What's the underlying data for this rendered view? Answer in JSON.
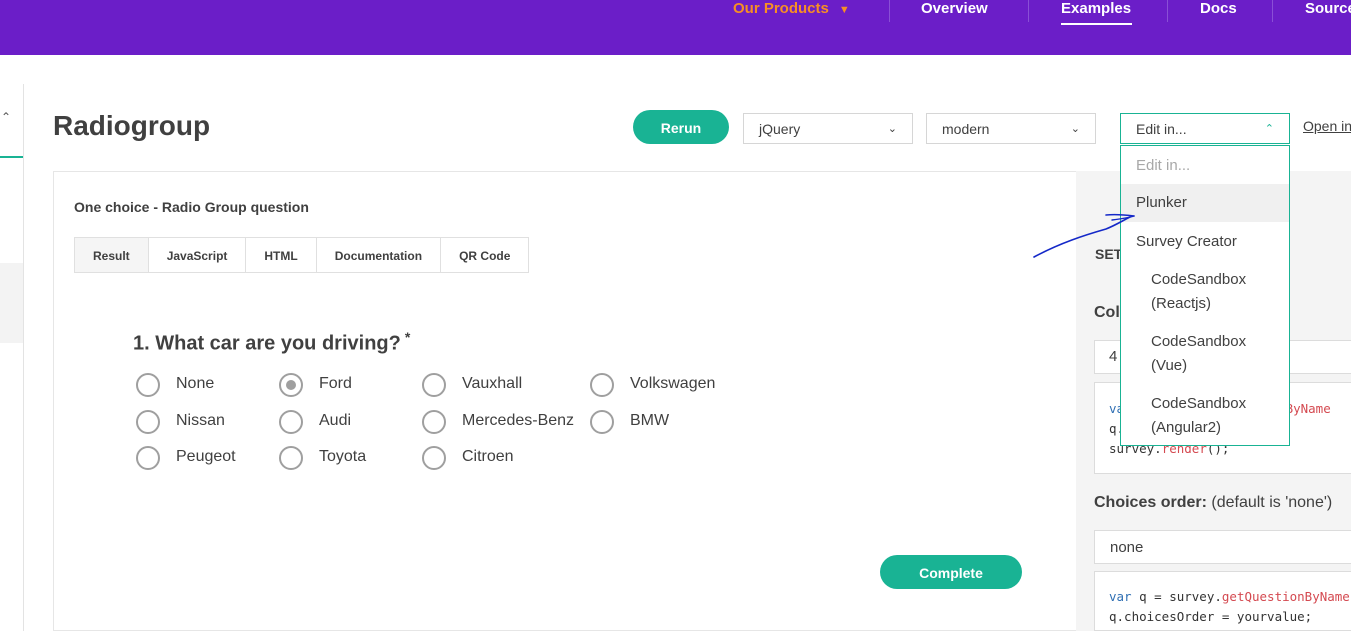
{
  "nav": {
    "products": "Our Products",
    "overview": "Overview",
    "examples": "Examples",
    "docs": "Docs",
    "source": "Source"
  },
  "icons": [
    "chevron-down-icon",
    "chevron-up-icon"
  ],
  "colors": {
    "brand": "#6b1ec8",
    "accent": "#19b394",
    "nav_highlight": "#f78e24"
  },
  "page": {
    "title": "Radiogroup",
    "rerun": "Rerun",
    "framework_value": "jQuery",
    "theme_value": "modern",
    "edit_value": "Edit in...",
    "open_in": "Open in"
  },
  "dropdown": {
    "items": [
      "Edit in...",
      "Plunker",
      "Survey Creator",
      "CodeSandbox (Reactjs)",
      "CodeSandbox (Vue)",
      "CodeSandbox (Angular2)"
    ],
    "lines": [
      [
        "Edit in..."
      ],
      [
        "Plunker"
      ],
      [
        "Survey Creator"
      ],
      [
        "CodeSandbox",
        "(Reactjs)"
      ],
      [
        "CodeSandbox",
        "(Vue)"
      ],
      [
        "CodeSandbox",
        "(Angular2)"
      ]
    ]
  },
  "example": {
    "title": "One choice - Radio Group question",
    "tabs": [
      "Result",
      "JavaScript",
      "HTML",
      "Documentation",
      "QR Code"
    ],
    "active_tab": "Result"
  },
  "survey": {
    "question": "1. What car are you driving?",
    "required_mark": "*",
    "choices": [
      "None",
      "Ford",
      "Vauxhall",
      "Volkswagen",
      "Nissan",
      "Audi",
      "Mercedes-Benz",
      "BMW",
      "Peugeot",
      "Toyota",
      "Citroen"
    ],
    "selected": "Ford",
    "complete": "Complete"
  },
  "settings": {
    "label": "SET",
    "column_label": "Colu",
    "column_value": "4",
    "code1": {
      "line1_kw": "va",
      "line1_fn": "ionByName",
      "line2": "q.",
      "line3_obj": "survey.",
      "line3_fn": "render",
      "line3_end": "();"
    },
    "order_label": "Choices order:",
    "order_hint": "(default is 'none')",
    "order_value": "none",
    "code2": {
      "line1_kw": "var",
      "line1_mid": " q = survey.",
      "line1_fn": "getQuestionByName",
      "line2": "q.choicesOrder = yourvalue;"
    }
  }
}
